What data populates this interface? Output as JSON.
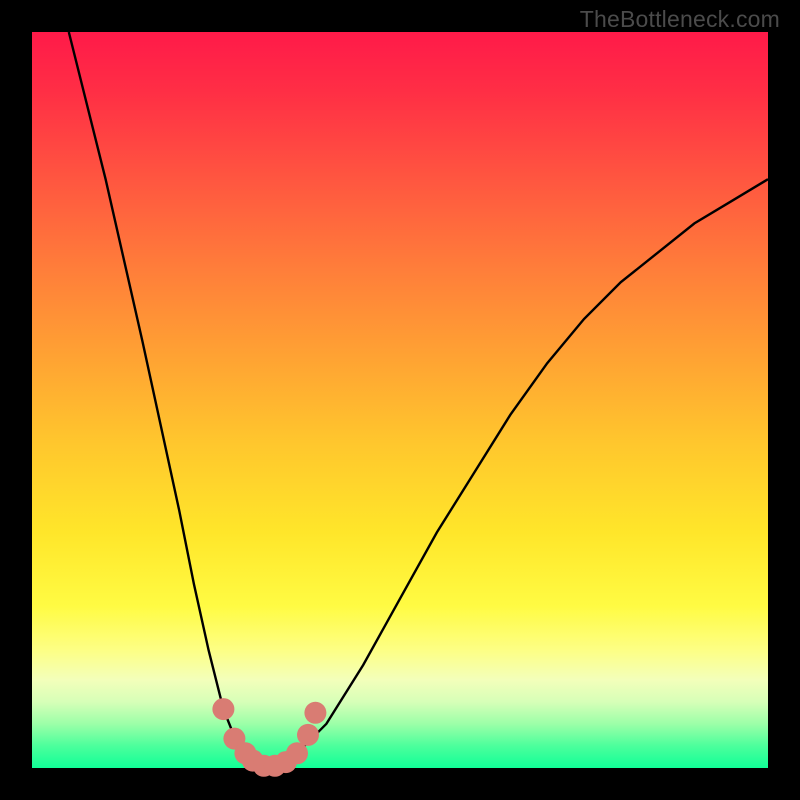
{
  "watermark": "TheBottleneck.com",
  "chart_data": {
    "type": "line",
    "title": "",
    "xlabel": "",
    "ylabel": "",
    "x_range": [
      0,
      100
    ],
    "y_range": [
      0,
      100
    ],
    "series": [
      {
        "name": "bottleneck-curve",
        "x": [
          5,
          10,
          15,
          20,
          22,
          24,
          26,
          28,
          30,
          32,
          34,
          36,
          40,
          45,
          50,
          55,
          60,
          65,
          70,
          75,
          80,
          85,
          90,
          95,
          100
        ],
        "values": [
          100,
          80,
          58,
          35,
          25,
          16,
          8,
          3,
          1,
          0,
          0,
          2,
          6,
          14,
          23,
          32,
          40,
          48,
          55,
          61,
          66,
          70,
          74,
          77,
          80
        ]
      }
    ],
    "markers": {
      "name": "highlight-dots",
      "color": "#d97c73",
      "points": [
        {
          "x": 26,
          "y": 8
        },
        {
          "x": 27.5,
          "y": 4
        },
        {
          "x": 29,
          "y": 2
        },
        {
          "x": 30,
          "y": 1
        },
        {
          "x": 31.5,
          "y": 0.3
        },
        {
          "x": 33,
          "y": 0.3
        },
        {
          "x": 34.5,
          "y": 0.8
        },
        {
          "x": 36,
          "y": 2
        },
        {
          "x": 37.5,
          "y": 4.5
        },
        {
          "x": 38.5,
          "y": 7.5
        }
      ]
    },
    "annotations": []
  }
}
